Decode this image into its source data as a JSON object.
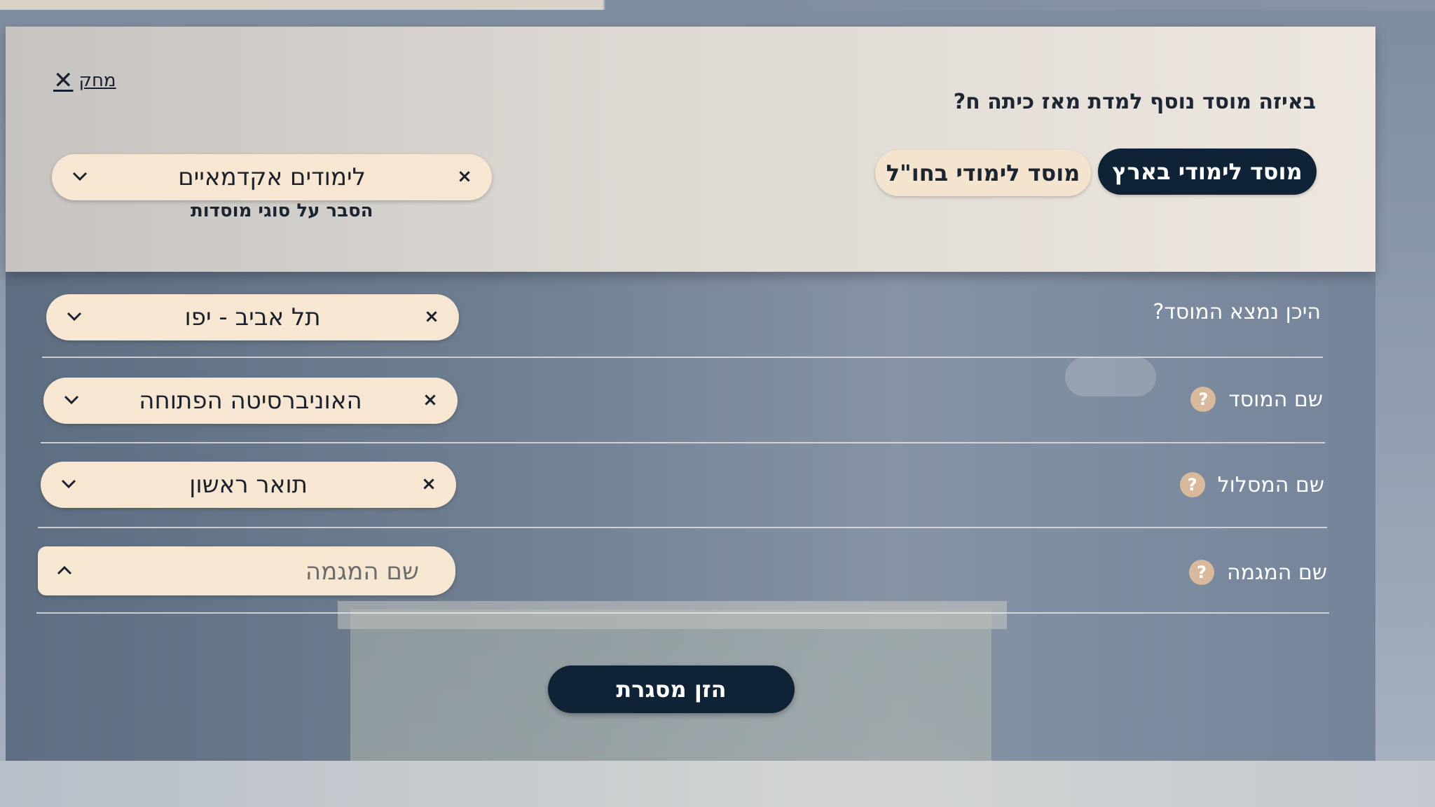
{
  "filter_panel": {
    "clear_label": "מחק",
    "clear_icon": "close-icon",
    "question": "באיזה מוסד נוסף למדת מאז כיתה ח?",
    "institution_in_israel_label": "מוסד לימודי בארץ",
    "institution_abroad_label": "מוסד לימודי בחו\"ל",
    "institution_type_value": "לימודים אקדמאיים",
    "institution_types_explanation_link": "הסבר על סוגי מוסדות"
  },
  "form": {
    "location": {
      "label": "היכן נמצא המוסד?",
      "value": "תל אביב - יפו"
    },
    "institution_name": {
      "label": "שם המוסד",
      "value": "האוניברסיטה הפתוחה"
    },
    "track_name": {
      "label": "שם המסלול",
      "value": "תואר ראשון"
    },
    "major_name": {
      "label": "שם המגמה",
      "placeholder": "שם המגמה",
      "value": ""
    },
    "help_glyph": "?",
    "clear_glyph": "×",
    "submit_label": "הזן מסגרת"
  },
  "colors": {
    "primary_dark": "#0f2236",
    "pill_background": "#f6e6d2",
    "help_badge": "#d8b99c"
  }
}
